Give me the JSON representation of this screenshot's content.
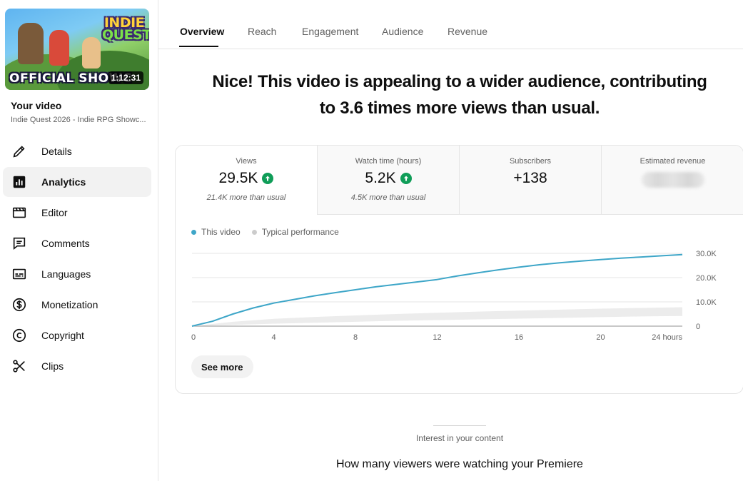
{
  "sidebar": {
    "thumbnail": {
      "logo_line1": "INDIE",
      "logo_line2": "QUEST",
      "overlay_text": "OFFICIAL SHOWC",
      "duration": "1:12:31"
    },
    "your_video_label": "Your video",
    "video_title": "Indie Quest 2026 - Indie RPG Showc...",
    "nav": [
      {
        "label": "Details",
        "icon": "pencil-icon"
      },
      {
        "label": "Analytics",
        "icon": "analytics-icon",
        "active": true
      },
      {
        "label": "Editor",
        "icon": "film-icon"
      },
      {
        "label": "Comments",
        "icon": "comment-icon"
      },
      {
        "label": "Languages",
        "icon": "subtitles-icon"
      },
      {
        "label": "Monetization",
        "icon": "dollar-icon"
      },
      {
        "label": "Copyright",
        "icon": "copyright-icon"
      },
      {
        "label": "Clips",
        "icon": "scissors-icon"
      }
    ]
  },
  "tabs": [
    "Overview",
    "Reach",
    "Engagement",
    "Audience",
    "Revenue"
  ],
  "active_tab": "Overview",
  "headline": {
    "line1": "Nice! This video is appealing to a wider audience, contributing",
    "line2": "to 3.6 times more views than usual."
  },
  "metrics": [
    {
      "label": "Views",
      "value": "29.5K",
      "note": "21.4K more than usual",
      "trend": "up"
    },
    {
      "label": "Watch time (hours)",
      "value": "5.2K",
      "note": "4.5K more than usual",
      "trend": "up"
    },
    {
      "label": "Subscribers",
      "value": "+138",
      "note": ""
    },
    {
      "label": "Estimated revenue",
      "value": "",
      "note": "",
      "redacted": true
    }
  ],
  "legend": {
    "this_video": "This video",
    "typical": "Typical performance"
  },
  "colors": {
    "this_video": "#3ea6c8",
    "typical": "#cccccc",
    "up_badge": "#0f9d58"
  },
  "chart_data": {
    "type": "line",
    "xlabel": "",
    "ylabel": "",
    "x_ticks": [
      "0",
      "4",
      "8",
      "12",
      "16",
      "20",
      "24 hours"
    ],
    "y_ticks": [
      "30.0K",
      "20.0K",
      "10.0K",
      "0"
    ],
    "ylim": [
      0,
      30000
    ],
    "xlim": [
      0,
      24
    ],
    "series": [
      {
        "name": "This video",
        "x": [
          0,
          1,
          2,
          3,
          4,
          5,
          6,
          7,
          8,
          9,
          10,
          11,
          12,
          13,
          14,
          15,
          16,
          17,
          18,
          19,
          20,
          21,
          22,
          23,
          24
        ],
        "values": [
          0,
          2000,
          5000,
          7500,
          9500,
          11000,
          12500,
          13800,
          15000,
          16200,
          17200,
          18200,
          19200,
          20700,
          22000,
          23200,
          24300,
          25300,
          26100,
          26800,
          27400,
          28000,
          28500,
          29000,
          29500
        ]
      },
      {
        "name": "Typical performance",
        "x": [
          0,
          2,
          4,
          6,
          8,
          10,
          12,
          14,
          16,
          18,
          20,
          22,
          24
        ],
        "low": [
          0,
          500,
          1000,
          1400,
          1800,
          2200,
          2500,
          2800,
          3100,
          3400,
          3700,
          4000,
          4200
        ],
        "high": [
          0,
          1800,
          3000,
          3800,
          4400,
          5000,
          5500,
          6000,
          6400,
          6800,
          7200,
          7500,
          7800
        ]
      }
    ]
  },
  "see_more_label": "See more",
  "interest_label": "Interest in your content",
  "premiere_title": "How many viewers were watching your Premiere"
}
